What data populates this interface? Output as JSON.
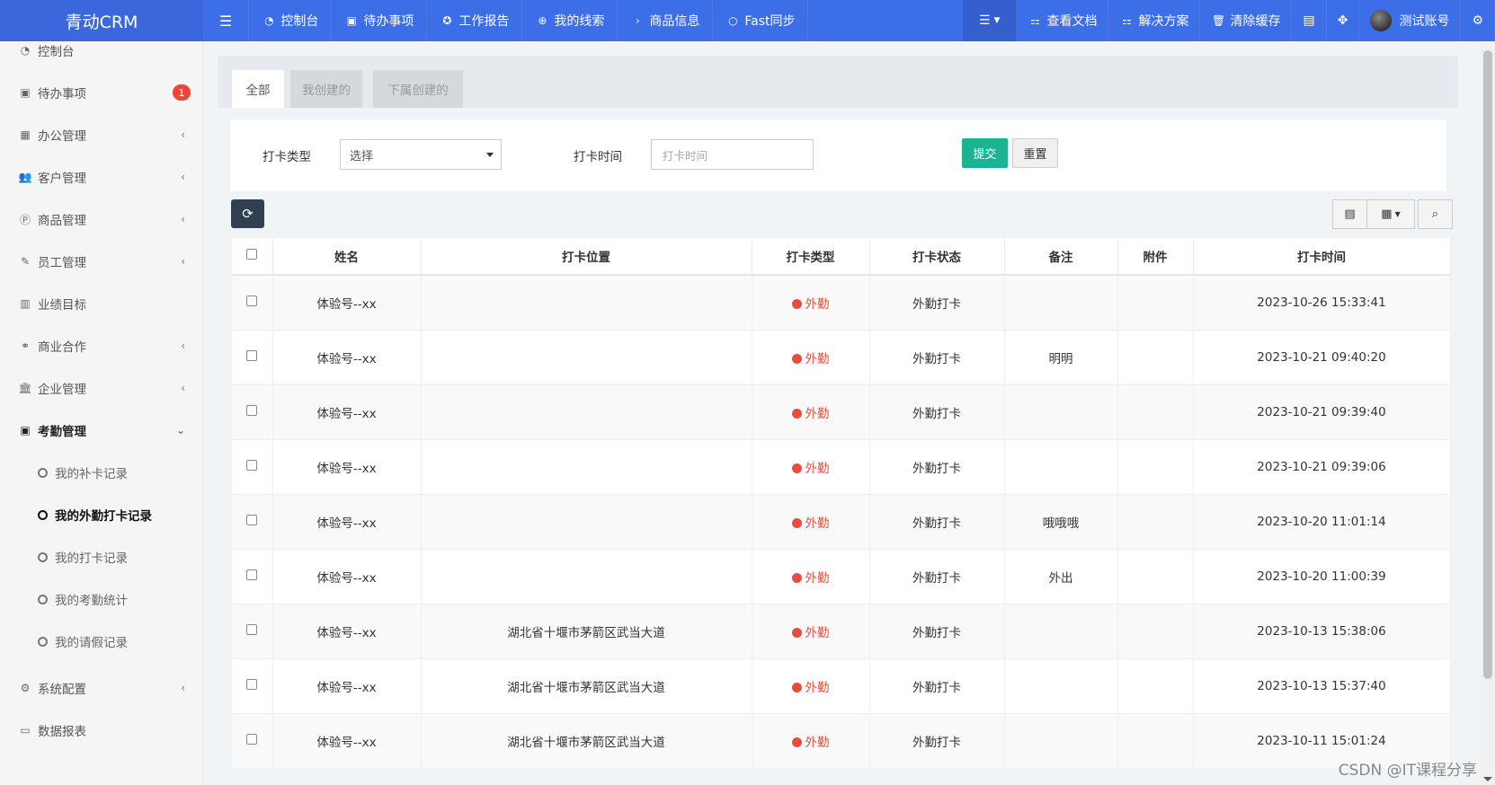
{
  "app": {
    "brand": "青动CRM"
  },
  "topnav": {
    "items": [
      {
        "label": "控制台",
        "icon": "dashboard-icon"
      },
      {
        "label": "待办事项",
        "icon": "calendar-icon"
      },
      {
        "label": "工作报告",
        "icon": "rebel-icon"
      },
      {
        "label": "我的线索",
        "icon": "search-plus-icon"
      },
      {
        "label": "商品信息",
        "icon": "chevron-right-icon"
      },
      {
        "label": "Fast同步",
        "icon": "circle-icon"
      }
    ],
    "right": [
      {
        "label": "查看文档",
        "icon": "sitemap-icon"
      },
      {
        "label": "解决方案",
        "icon": "sitemap-icon"
      },
      {
        "label": "清除缓存",
        "icon": "trash-icon"
      }
    ],
    "user": "测试账号"
  },
  "sidebar": {
    "items": [
      {
        "label": "控制台",
        "icon": "dashboard-icon"
      },
      {
        "label": "待办事项",
        "icon": "calendar-check-icon",
        "badge": "1"
      },
      {
        "label": "办公管理",
        "icon": "windows-icon"
      },
      {
        "label": "客户管理",
        "icon": "users-icon"
      },
      {
        "label": "商品管理",
        "icon": "product-hunt-icon"
      },
      {
        "label": "员工管理",
        "icon": "brush-icon"
      },
      {
        "label": "业绩目标",
        "icon": "bar-chart-icon"
      },
      {
        "label": "商业合作",
        "icon": "handshake-icon"
      },
      {
        "label": "企业管理",
        "icon": "bank-icon"
      },
      {
        "label": "考勤管理",
        "icon": "calendar-icon"
      }
    ],
    "sub": [
      {
        "label": "我的补卡记录"
      },
      {
        "label": "我的外勤打卡记录"
      },
      {
        "label": "我的打卡记录"
      },
      {
        "label": "我的考勤统计"
      },
      {
        "label": "我的请假记录"
      }
    ],
    "bottom": [
      {
        "label": "系统配置",
        "icon": "cog-icon"
      },
      {
        "label": "数据报表",
        "icon": "laptop-icon"
      }
    ]
  },
  "tabs": [
    "全部",
    "我创建的",
    "下属创建的"
  ],
  "filter": {
    "type_label": "打卡类型",
    "type_value": "选择",
    "time_label": "打卡时间",
    "time_placeholder": "打卡时间",
    "submit": "提交",
    "reset": "重置"
  },
  "table": {
    "headers": [
      "姓名",
      "打卡位置",
      "打卡类型",
      "打卡状态",
      "备注",
      "附件",
      "打卡时间"
    ],
    "rows": [
      {
        "name": "体验号--xx",
        "location": "",
        "type": "外勤",
        "status": "外勤打卡",
        "note": "",
        "attachment": "",
        "time": "2023-10-26 15:33:41"
      },
      {
        "name": "体验号--xx",
        "location": "",
        "type": "外勤",
        "status": "外勤打卡",
        "note": "明明",
        "attachment": "",
        "time": "2023-10-21 09:40:20"
      },
      {
        "name": "体验号--xx",
        "location": "",
        "type": "外勤",
        "status": "外勤打卡",
        "note": "",
        "attachment": "",
        "time": "2023-10-21 09:39:40"
      },
      {
        "name": "体验号--xx",
        "location": "",
        "type": "外勤",
        "status": "外勤打卡",
        "note": "",
        "attachment": "",
        "time": "2023-10-21 09:39:06"
      },
      {
        "name": "体验号--xx",
        "location": "",
        "type": "外勤",
        "status": "外勤打卡",
        "note": "哦哦哦",
        "attachment": "",
        "time": "2023-10-20 11:01:14"
      },
      {
        "name": "体验号--xx",
        "location": "",
        "type": "外勤",
        "status": "外勤打卡",
        "note": "外出",
        "attachment": "",
        "time": "2023-10-20 11:00:39"
      },
      {
        "name": "体验号--xx",
        "location": "湖北省十堰市茅箭区武当大道",
        "type": "外勤",
        "status": "外勤打卡",
        "note": "",
        "attachment": "",
        "time": "2023-10-13 15:38:06"
      },
      {
        "name": "体验号--xx",
        "location": "湖北省十堰市茅箭区武当大道",
        "type": "外勤",
        "status": "外勤打卡",
        "note": "",
        "attachment": "",
        "time": "2023-10-13 15:37:40"
      },
      {
        "name": "体验号--xx",
        "location": "湖北省十堰市茅箭区武当大道",
        "type": "外勤",
        "status": "外勤打卡",
        "note": "",
        "attachment": "",
        "time": "2023-10-11 15:01:24"
      }
    ]
  },
  "colors": {
    "topbar": "#3c6ee8",
    "accent_green": "#1ab394",
    "accent_red": "#e74c3c",
    "refresh_btn": "#2f4050"
  },
  "watermark": "CSDN @IT课程分享"
}
